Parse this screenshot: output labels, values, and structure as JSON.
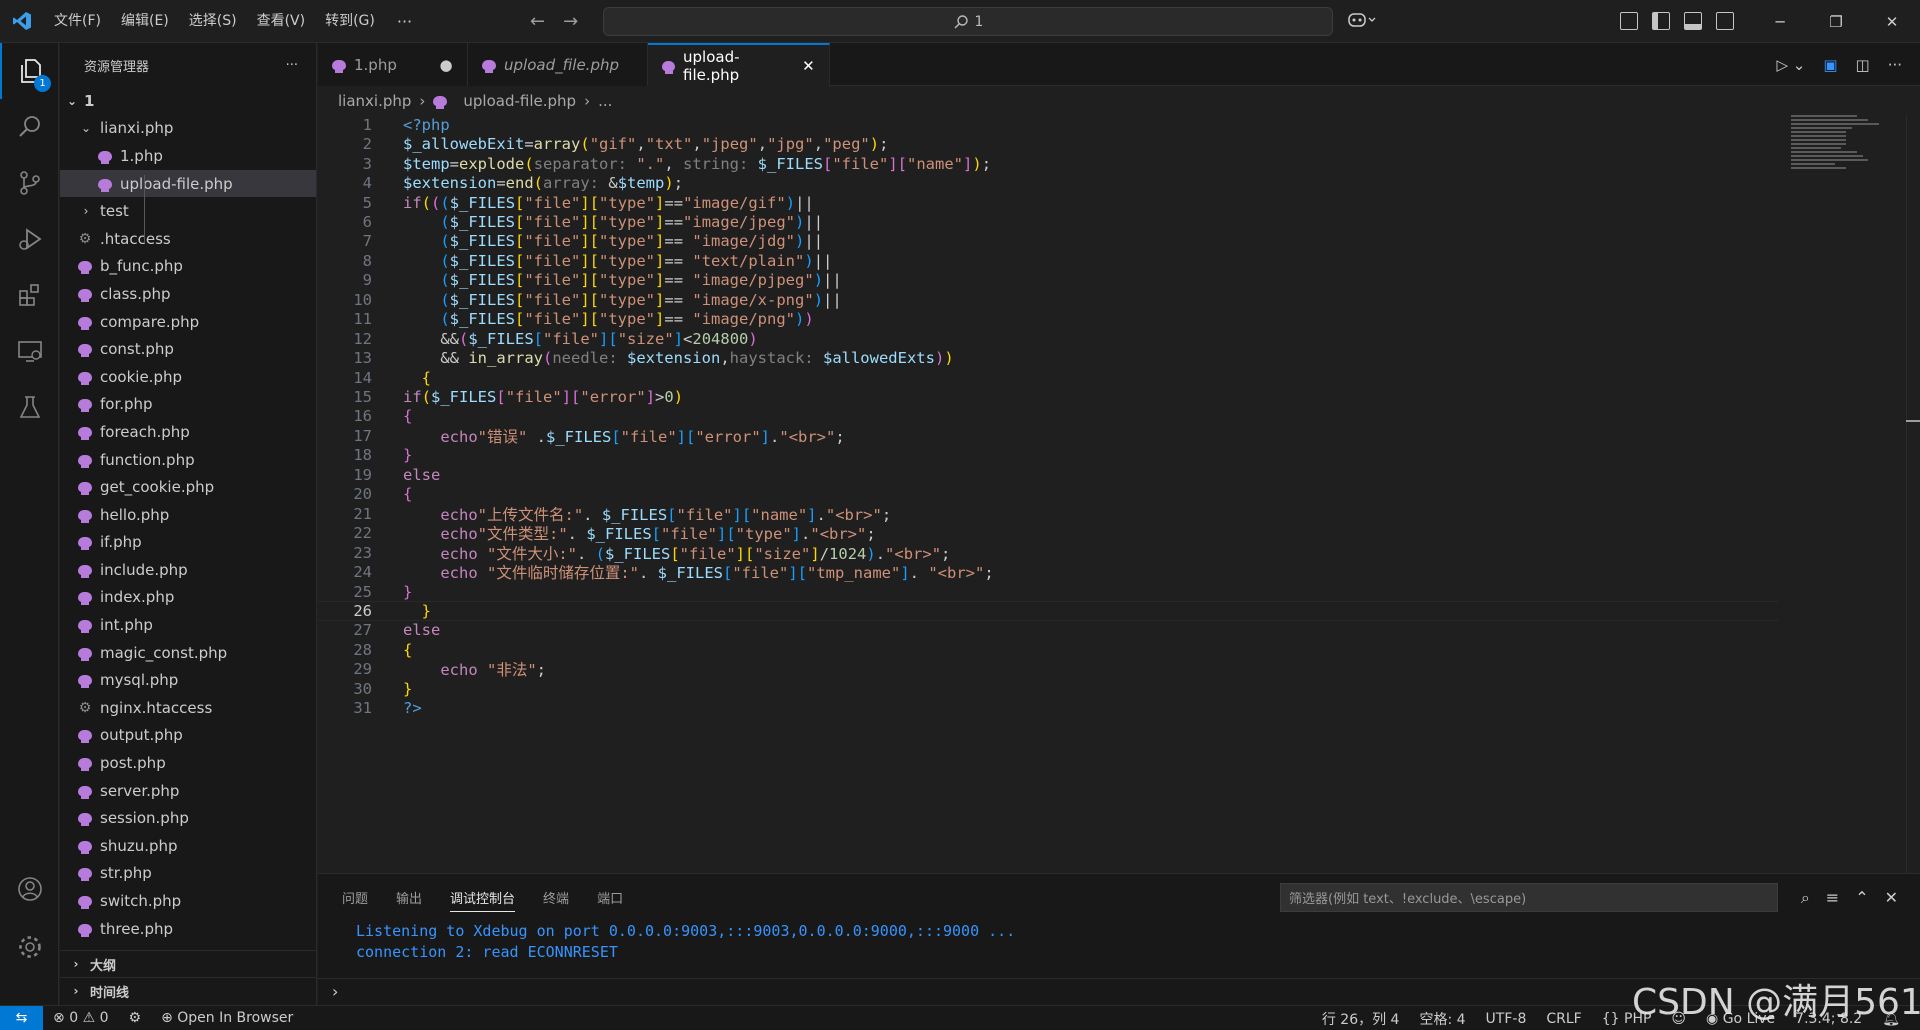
{
  "titlebar": {
    "menus": [
      "文件(F)",
      "编辑(E)",
      "选择(S)",
      "查看(V)",
      "转到(G)"
    ],
    "more": "···",
    "search_text": "1"
  },
  "activity": {
    "explorer_badge": "1"
  },
  "sidebar": {
    "title": "资源管理器",
    "more": "···",
    "root": "1",
    "tree": [
      {
        "label": "lianxi.php",
        "level": 1,
        "type": "folder-open"
      },
      {
        "label": "1.php",
        "level": 2,
        "type": "php"
      },
      {
        "label": "upload-file.php",
        "level": 2,
        "type": "php",
        "selected": true
      },
      {
        "label": "test",
        "level": 1,
        "type": "folder-closed"
      },
      {
        "label": ".htaccess",
        "level": 1,
        "type": "config"
      },
      {
        "label": "b_func.php",
        "level": 1,
        "type": "php"
      },
      {
        "label": "class.php",
        "level": 1,
        "type": "php"
      },
      {
        "label": "compare.php",
        "level": 1,
        "type": "php"
      },
      {
        "label": "const.php",
        "level": 1,
        "type": "php"
      },
      {
        "label": "cookie.php",
        "level": 1,
        "type": "php"
      },
      {
        "label": "for.php",
        "level": 1,
        "type": "php"
      },
      {
        "label": "foreach.php",
        "level": 1,
        "type": "php"
      },
      {
        "label": "function.php",
        "level": 1,
        "type": "php"
      },
      {
        "label": "get_cookie.php",
        "level": 1,
        "type": "php"
      },
      {
        "label": "hello.php",
        "level": 1,
        "type": "php"
      },
      {
        "label": "if.php",
        "level": 1,
        "type": "php"
      },
      {
        "label": "include.php",
        "level": 1,
        "type": "php"
      },
      {
        "label": "index.php",
        "level": 1,
        "type": "php"
      },
      {
        "label": "int.php",
        "level": 1,
        "type": "php"
      },
      {
        "label": "magic_const.php",
        "level": 1,
        "type": "php"
      },
      {
        "label": "mysql.php",
        "level": 1,
        "type": "php"
      },
      {
        "label": "nginx.htaccess",
        "level": 1,
        "type": "config"
      },
      {
        "label": "output.php",
        "level": 1,
        "type": "php"
      },
      {
        "label": "post.php",
        "level": 1,
        "type": "php"
      },
      {
        "label": "server.php",
        "level": 1,
        "type": "php"
      },
      {
        "label": "session.php",
        "level": 1,
        "type": "php"
      },
      {
        "label": "shuzu.php",
        "level": 1,
        "type": "php"
      },
      {
        "label": "str.php",
        "level": 1,
        "type": "php"
      },
      {
        "label": "switch.php",
        "level": 1,
        "type": "php"
      },
      {
        "label": "three.php",
        "level": 1,
        "type": "php"
      }
    ],
    "outline_label": "大纲",
    "timeline_label": "时间线"
  },
  "tabs": [
    {
      "label": "1.php",
      "state": "dirty",
      "close": "●"
    },
    {
      "label": "upload_file.php",
      "state": "preview",
      "close": ""
    },
    {
      "label": "upload-file.php",
      "state": "active",
      "close": "✕"
    }
  ],
  "breadcrumb": {
    "folder": "lianxi.php",
    "file": "upload-file.php",
    "tail": "..."
  },
  "editor": {
    "current_line": 26,
    "lines": [
      [
        [
          "tag",
          "<?php"
        ]
      ],
      [
        [
          "v",
          "$_allowebExit"
        ],
        [
          "p",
          "="
        ],
        [
          "f",
          "array"
        ],
        [
          "b1",
          "("
        ],
        [
          "s",
          "\"gif\""
        ],
        [
          "p",
          ","
        ],
        [
          "s",
          "\"txt\""
        ],
        [
          "p",
          ","
        ],
        [
          "s",
          "\"jpeg\""
        ],
        [
          "p",
          ","
        ],
        [
          "s",
          "\"jpg\""
        ],
        [
          "p",
          ","
        ],
        [
          "s",
          "\"peg\""
        ],
        [
          "b1",
          ")"
        ],
        [
          "p",
          ";"
        ]
      ],
      [
        [
          "v",
          "$temp"
        ],
        [
          "p",
          "="
        ],
        [
          "f",
          "explode"
        ],
        [
          "b1",
          "("
        ],
        [
          "h",
          "separator: "
        ],
        [
          "s",
          "\".\""
        ],
        [
          "p",
          ", "
        ],
        [
          "h",
          "string: "
        ],
        [
          "v",
          "$_FILES"
        ],
        [
          "b2",
          "["
        ],
        [
          "s",
          "\"file\""
        ],
        [
          "b2",
          "]["
        ],
        [
          "s",
          "\"name\""
        ],
        [
          "b2",
          "]"
        ],
        [
          "b1",
          ")"
        ],
        [
          "p",
          ";"
        ]
      ],
      [
        [
          "v",
          "$extension"
        ],
        [
          "p",
          "="
        ],
        [
          "f",
          "end"
        ],
        [
          "b1",
          "("
        ],
        [
          "h",
          "array: "
        ],
        [
          "p",
          "&"
        ],
        [
          "v",
          "$temp"
        ],
        [
          "b1",
          ")"
        ],
        [
          "p",
          ";"
        ]
      ],
      [
        [
          "ctl",
          "if"
        ],
        [
          "b1",
          "("
        ],
        [
          "b2",
          "("
        ],
        [
          "b3",
          "("
        ],
        [
          "v",
          "$_FILES"
        ],
        [
          "b1",
          "["
        ],
        [
          "s",
          "\"file\""
        ],
        [
          "b1",
          "]["
        ],
        [
          "s",
          "\"type\""
        ],
        [
          "b1",
          "]"
        ],
        [
          "p",
          "=="
        ],
        [
          "s",
          "\"image/gif\""
        ],
        [
          "b3",
          ")"
        ],
        [
          "p",
          "||"
        ]
      ],
      [
        [
          "p",
          "    "
        ],
        [
          "b3",
          "("
        ],
        [
          "v",
          "$_FILES"
        ],
        [
          "b1",
          "["
        ],
        [
          "s",
          "\"file\""
        ],
        [
          "b1",
          "]["
        ],
        [
          "s",
          "\"type\""
        ],
        [
          "b1",
          "]"
        ],
        [
          "p",
          "=="
        ],
        [
          "s",
          "\"image/jpeg\""
        ],
        [
          "b3",
          ")"
        ],
        [
          "p",
          "||"
        ]
      ],
      [
        [
          "p",
          "    "
        ],
        [
          "b3",
          "("
        ],
        [
          "v",
          "$_FILES"
        ],
        [
          "b1",
          "["
        ],
        [
          "s",
          "\"file\""
        ],
        [
          "b1",
          "]["
        ],
        [
          "s",
          "\"type\""
        ],
        [
          "b1",
          "]"
        ],
        [
          "p",
          "== "
        ],
        [
          "s",
          "\"image/jdg\""
        ],
        [
          "b3",
          ")"
        ],
        [
          "p",
          "||"
        ]
      ],
      [
        [
          "p",
          "    "
        ],
        [
          "b3",
          "("
        ],
        [
          "v",
          "$_FILES"
        ],
        [
          "b1",
          "["
        ],
        [
          "s",
          "\"file\""
        ],
        [
          "b1",
          "]["
        ],
        [
          "s",
          "\"type\""
        ],
        [
          "b1",
          "]"
        ],
        [
          "p",
          "== "
        ],
        [
          "s",
          "\"text/plain\""
        ],
        [
          "b3",
          ")"
        ],
        [
          "p",
          "||"
        ]
      ],
      [
        [
          "p",
          "    "
        ],
        [
          "b3",
          "("
        ],
        [
          "v",
          "$_FILES"
        ],
        [
          "b1",
          "["
        ],
        [
          "s",
          "\"file\""
        ],
        [
          "b1",
          "]["
        ],
        [
          "s",
          "\"type\""
        ],
        [
          "b1",
          "]"
        ],
        [
          "p",
          "== "
        ],
        [
          "s",
          "\"image/pjpeg\""
        ],
        [
          "b3",
          ")"
        ],
        [
          "p",
          "||"
        ]
      ],
      [
        [
          "p",
          "    "
        ],
        [
          "b3",
          "("
        ],
        [
          "v",
          "$_FILES"
        ],
        [
          "b1",
          "["
        ],
        [
          "s",
          "\"file\""
        ],
        [
          "b1",
          "]["
        ],
        [
          "s",
          "\"type\""
        ],
        [
          "b1",
          "]"
        ],
        [
          "p",
          "== "
        ],
        [
          "s",
          "\"image/x-png\""
        ],
        [
          "b3",
          ")"
        ],
        [
          "p",
          "||"
        ]
      ],
      [
        [
          "p",
          "    "
        ],
        [
          "b3",
          "("
        ],
        [
          "v",
          "$_FILES"
        ],
        [
          "b1",
          "["
        ],
        [
          "s",
          "\"file\""
        ],
        [
          "b1",
          "]["
        ],
        [
          "s",
          "\"type\""
        ],
        [
          "b1",
          "]"
        ],
        [
          "p",
          "== "
        ],
        [
          "s",
          "\"image/png\""
        ],
        [
          "b3",
          ")"
        ],
        [
          "b2",
          ")"
        ]
      ],
      [
        [
          "p",
          "    &&"
        ],
        [
          "b2",
          "("
        ],
        [
          "v",
          "$_FILES"
        ],
        [
          "b3",
          "["
        ],
        [
          "s",
          "\"file\""
        ],
        [
          "b3",
          "]["
        ],
        [
          "s",
          "\"size\""
        ],
        [
          "b3",
          "]"
        ],
        [
          "p",
          "<"
        ],
        [
          "n",
          "204800"
        ],
        [
          "b2",
          ")"
        ]
      ],
      [
        [
          "p",
          "    && "
        ],
        [
          "f",
          "in_array"
        ],
        [
          "b2",
          "("
        ],
        [
          "h",
          "needle: "
        ],
        [
          "v",
          "$extension"
        ],
        [
          "p",
          ","
        ],
        [
          "h",
          "haystack: "
        ],
        [
          "v",
          "$allowedExts"
        ],
        [
          "b2",
          ")"
        ],
        [
          "b1",
          ")"
        ]
      ],
      [
        [
          "p",
          "  "
        ],
        [
          "b1",
          "{"
        ]
      ],
      [
        [
          "ctl",
          "if"
        ],
        [
          "b1",
          "("
        ],
        [
          "v",
          "$_FILES"
        ],
        [
          "b2",
          "["
        ],
        [
          "s",
          "\"file\""
        ],
        [
          "b2",
          "]["
        ],
        [
          "s",
          "\"error\""
        ],
        [
          "b2",
          "]"
        ],
        [
          "p",
          ">"
        ],
        [
          "n",
          "0"
        ],
        [
          "b1",
          ")"
        ]
      ],
      [
        [
          "b2",
          "{"
        ]
      ],
      [
        [
          "p",
          "    "
        ],
        [
          "k",
          "echo"
        ],
        [
          "s",
          "\"错误\""
        ],
        [
          "p",
          " ."
        ],
        [
          "v",
          "$_FILES"
        ],
        [
          "b3",
          "["
        ],
        [
          "s",
          "\"file\""
        ],
        [
          "b3",
          "]["
        ],
        [
          "s",
          "\"error\""
        ],
        [
          "b3",
          "]"
        ],
        [
          "p",
          "."
        ],
        [
          "s",
          "\"<br>\""
        ],
        [
          "p",
          ";"
        ]
      ],
      [
        [
          "b2",
          "}"
        ]
      ],
      [
        [
          "ctl",
          "else"
        ]
      ],
      [
        [
          "b2",
          "{"
        ]
      ],
      [
        [
          "p",
          "    "
        ],
        [
          "k",
          "echo"
        ],
        [
          "s",
          "\"上传文件名:\""
        ],
        [
          "p",
          ". "
        ],
        [
          "v",
          "$_FILES"
        ],
        [
          "b3",
          "["
        ],
        [
          "s",
          "\"file\""
        ],
        [
          "b3",
          "]["
        ],
        [
          "s",
          "\"name\""
        ],
        [
          "b3",
          "]"
        ],
        [
          "p",
          "."
        ],
        [
          "s",
          "\"<br>\""
        ],
        [
          "p",
          ";"
        ]
      ],
      [
        [
          "p",
          "    "
        ],
        [
          "k",
          "echo"
        ],
        [
          "s",
          "\"文件类型:\""
        ],
        [
          "p",
          ". "
        ],
        [
          "v",
          "$_FILES"
        ],
        [
          "b3",
          "["
        ],
        [
          "s",
          "\"file\""
        ],
        [
          "b3",
          "]["
        ],
        [
          "s",
          "\"type\""
        ],
        [
          "b3",
          "]"
        ],
        [
          "p",
          "."
        ],
        [
          "s",
          "\"<br>\""
        ],
        [
          "p",
          ";"
        ]
      ],
      [
        [
          "p",
          "    "
        ],
        [
          "k",
          "echo"
        ],
        [
          "s",
          " \"文件大小:\""
        ],
        [
          "p",
          ". "
        ],
        [
          "b3",
          "("
        ],
        [
          "v",
          "$_FILES"
        ],
        [
          "b1",
          "["
        ],
        [
          "s",
          "\"file\""
        ],
        [
          "b1",
          "]["
        ],
        [
          "s",
          "\"size\""
        ],
        [
          "b1",
          "]"
        ],
        [
          "p",
          "/"
        ],
        [
          "n",
          "1024"
        ],
        [
          "b3",
          ")"
        ],
        [
          "p",
          "."
        ],
        [
          "s",
          "\"<br>\""
        ],
        [
          "p",
          ";"
        ]
      ],
      [
        [
          "p",
          "    "
        ],
        [
          "k",
          "echo"
        ],
        [
          "s",
          " \"文件临时储存位置:\""
        ],
        [
          "p",
          ". "
        ],
        [
          "v",
          "$_FILES"
        ],
        [
          "b3",
          "["
        ],
        [
          "s",
          "\"file\""
        ],
        [
          "b3",
          "]["
        ],
        [
          "s",
          "\"tmp_name\""
        ],
        [
          "b3",
          "]"
        ],
        [
          "p",
          ". "
        ],
        [
          "s",
          "\"<br>\""
        ],
        [
          "p",
          ";"
        ]
      ],
      [
        [
          "b2",
          "}"
        ]
      ],
      [
        [
          "p",
          "  "
        ],
        [
          "b1",
          "}"
        ]
      ],
      [
        [
          "ctl",
          "else"
        ]
      ],
      [
        [
          "b1",
          "{"
        ]
      ],
      [
        [
          "p",
          "    "
        ],
        [
          "k",
          "echo"
        ],
        [
          "s",
          " \"非法\""
        ],
        [
          "p",
          ";"
        ]
      ],
      [
        [
          "b1",
          "}"
        ]
      ],
      [
        [
          "tag",
          "?>"
        ]
      ]
    ]
  },
  "panel": {
    "tabs": [
      "问题",
      "输出",
      "调试控制台",
      "终端",
      "端口"
    ],
    "active_tab": "调试控制台",
    "filter_placeholder": "筛选器(例如 text、!exclude、\\escape)",
    "console_lines": [
      "Listening to Xdebug on port 0.0.0.0:9003,:::9003,0.0.0.0:9000,:::9000 ...",
      "connection 2: read ECONNRESET"
    ],
    "prompt": "›"
  },
  "statusbar": {
    "errors": "0",
    "warnings": "0",
    "open_in_browser": "Open In Browser",
    "position": "行 26，列 4",
    "spaces": "空格: 4",
    "encoding": "UTF-8",
    "eol": "CRLF",
    "language": "PHP",
    "go_live": "Go Live",
    "php_version": "7.3.4; 8.2"
  },
  "watermark": "CSDN @满月561",
  "colors": {
    "accent": "#0078d4",
    "php_icon": "#b77bdb",
    "console_text": "#3794ff"
  }
}
